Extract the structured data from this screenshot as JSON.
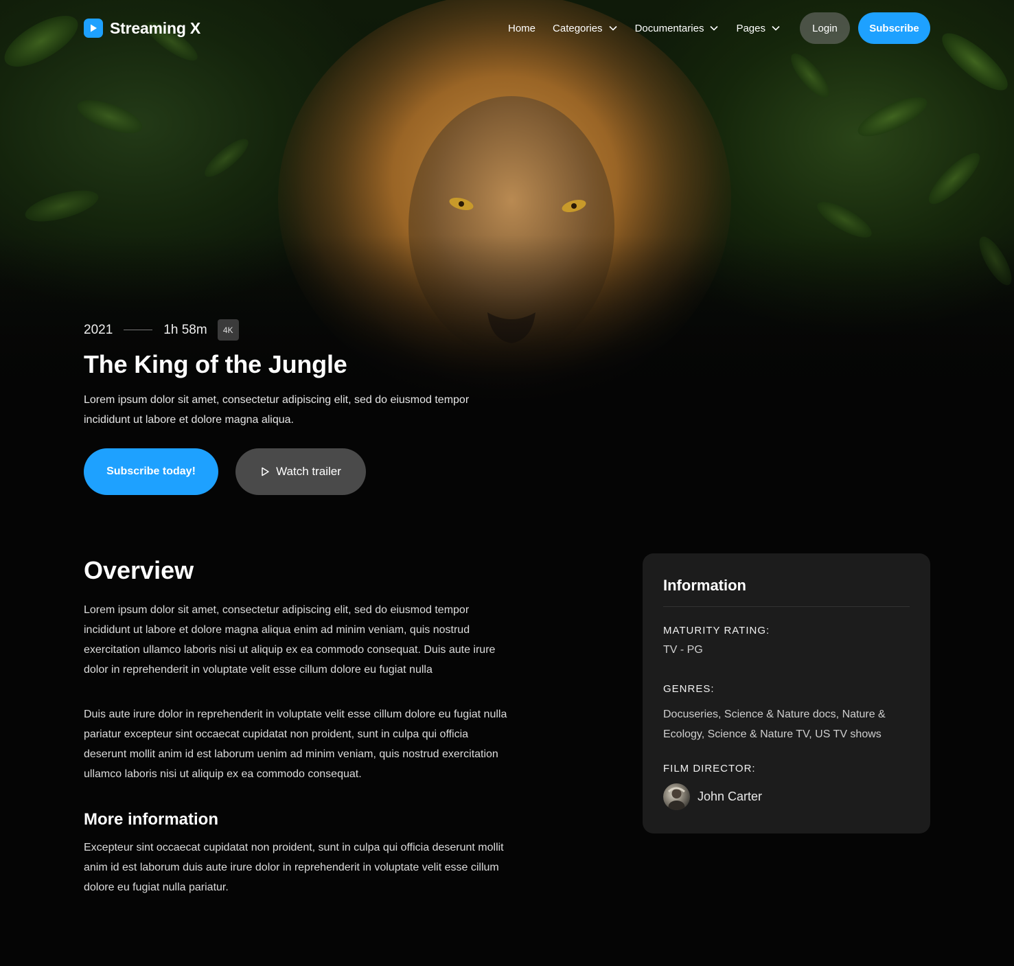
{
  "header": {
    "brand": "Streaming X",
    "nav": [
      {
        "label": "Home",
        "dropdown": false
      },
      {
        "label": "Categories",
        "dropdown": true
      },
      {
        "label": "Documentaries",
        "dropdown": true
      },
      {
        "label": "Pages",
        "dropdown": true
      }
    ],
    "login_label": "Login",
    "subscribe_label": "Subscribe"
  },
  "hero": {
    "year": "2021",
    "duration": "1h 58m",
    "quality_badge": "4K",
    "title": "The King of the Jungle",
    "description": "Lorem ipsum dolor sit amet, consectetur adipiscing elit, sed do eiusmod tempor incididunt ut labore et dolore magna aliqua.",
    "primary_cta": "Subscribe today!",
    "secondary_cta": "Watch trailer"
  },
  "overview": {
    "title": "Overview",
    "paragraph_1": "Lorem ipsum dolor sit amet, consectetur adipiscing elit, sed do eiusmod tempor incididunt ut labore et dolore magna aliqua enim ad minim veniam, quis nostrud exercitation ullamco laboris nisi ut aliquip ex ea commodo consequat. Duis aute irure dolor in reprehenderit in voluptate velit esse cillum dolore eu fugiat nulla",
    "paragraph_2": "Duis aute irure dolor in reprehenderit in voluptate velit esse cillum dolore eu fugiat nulla pariatur excepteur sint occaecat cupidatat non proident, sunt in culpa qui officia deserunt mollit anim id est laborum uenim ad minim veniam, quis nostrud exercitation ullamco laboris nisi ut aliquip ex ea commodo consequat.",
    "more_title": "More information",
    "more_text": "Excepteur sint occaecat cupidatat non proident, sunt in culpa qui officia deserunt mollit anim id est laborum duis aute irure dolor in reprehenderit in voluptate velit esse cillum dolore eu fugiat nulla pariatur."
  },
  "info": {
    "title": "Information",
    "maturity_label": "MATURITY RATING:",
    "maturity_value": "TV - PG",
    "genres_label": "GENRES:",
    "genres_value": "Docuseries, Science & Nature docs, Nature & Ecology, Science & Nature TV, US TV shows",
    "director_label": "FILM DIRECTOR:",
    "director_name": "John Carter"
  },
  "colors": {
    "accent": "#1ea1ff",
    "background": "#050505",
    "card": "#1c1c1c"
  }
}
